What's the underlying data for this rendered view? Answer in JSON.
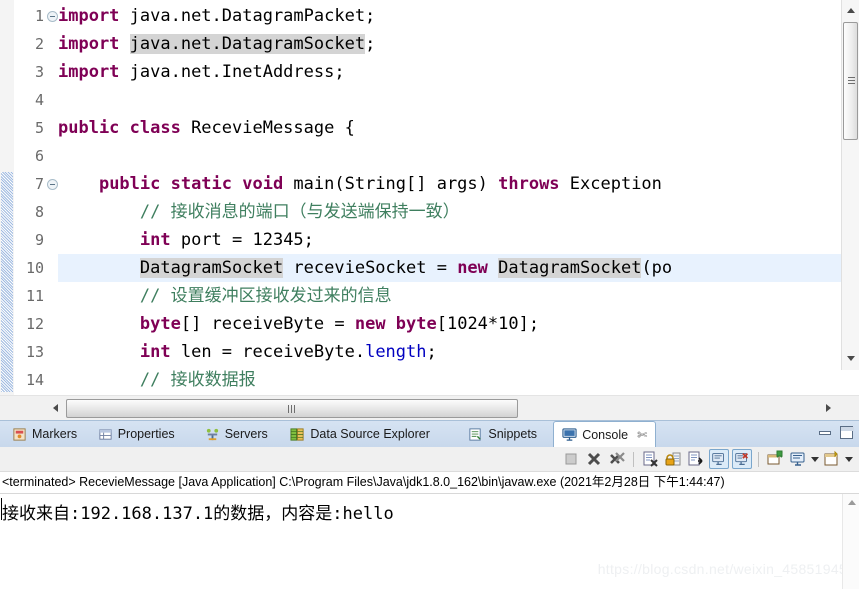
{
  "editor": {
    "lines": [
      {
        "n": "1",
        "fold": true,
        "cur": false,
        "segs": [
          {
            "t": "import ",
            "c": "kw"
          },
          {
            "t": "java.net.DatagramPacket;",
            "c": ""
          }
        ]
      },
      {
        "n": "2",
        "fold": false,
        "cur": false,
        "segs": [
          {
            "t": "import ",
            "c": "kw"
          },
          {
            "t": "java.net.DatagramSocket",
            "c": "occ"
          },
          {
            "t": ";",
            "c": ""
          }
        ]
      },
      {
        "n": "3",
        "fold": false,
        "cur": false,
        "segs": [
          {
            "t": "import ",
            "c": "kw"
          },
          {
            "t": "java.net.InetAddress;",
            "c": ""
          }
        ]
      },
      {
        "n": "4",
        "fold": false,
        "cur": false,
        "segs": []
      },
      {
        "n": "5",
        "fold": false,
        "cur": false,
        "segs": [
          {
            "t": "public class ",
            "c": "kw"
          },
          {
            "t": "RecevieMessage {",
            "c": ""
          }
        ]
      },
      {
        "n": "6",
        "fold": false,
        "cur": false,
        "segs": []
      },
      {
        "n": "7",
        "fold": true,
        "cur": false,
        "segs": [
          {
            "t": "    ",
            "c": ""
          },
          {
            "t": "public static void ",
            "c": "kw"
          },
          {
            "t": "main(String[] args) ",
            "c": ""
          },
          {
            "t": "throws ",
            "c": "kw"
          },
          {
            "t": "Exception",
            "c": ""
          }
        ]
      },
      {
        "n": "8",
        "fold": false,
        "cur": false,
        "segs": [
          {
            "t": "        // 接收消息的端口（与发送端保持一致）",
            "c": "cmt"
          }
        ]
      },
      {
        "n": "9",
        "fold": false,
        "cur": false,
        "segs": [
          {
            "t": "        ",
            "c": ""
          },
          {
            "t": "int ",
            "c": "kw"
          },
          {
            "t": "port = 12345;",
            "c": ""
          }
        ]
      },
      {
        "n": "10",
        "fold": false,
        "cur": true,
        "segs": [
          {
            "t": "        ",
            "c": ""
          },
          {
            "t": "DatagramSocket",
            "c": "occ"
          },
          {
            "t": " recevieSocket = ",
            "c": ""
          },
          {
            "t": "new ",
            "c": "kw"
          },
          {
            "t": "DatagramSocket",
            "c": "occ"
          },
          {
            "t": "(po",
            "c": ""
          }
        ]
      },
      {
        "n": "11",
        "fold": false,
        "cur": false,
        "segs": [
          {
            "t": "        // 设置缓冲区接收发过来的信息",
            "c": "cmt"
          }
        ]
      },
      {
        "n": "12",
        "fold": false,
        "cur": false,
        "segs": [
          {
            "t": "        ",
            "c": ""
          },
          {
            "t": "byte",
            "c": "kw"
          },
          {
            "t": "[] receiveByte = ",
            "c": ""
          },
          {
            "t": "new byte",
            "c": "kw"
          },
          {
            "t": "[1024*10];",
            "c": ""
          }
        ]
      },
      {
        "n": "13",
        "fold": false,
        "cur": false,
        "segs": [
          {
            "t": "        ",
            "c": ""
          },
          {
            "t": "int ",
            "c": "kw"
          },
          {
            "t": "len = receiveByte.",
            "c": ""
          },
          {
            "t": "length",
            "c": "fld"
          },
          {
            "t": ";",
            "c": ""
          }
        ]
      },
      {
        "n": "14",
        "fold": false,
        "cur": false,
        "segs": [
          {
            "t": "        // 接收数据报",
            "c": "cmt"
          }
        ]
      }
    ]
  },
  "views": {
    "tabs": [
      {
        "label": "Markers",
        "icon": "markers-icon",
        "active": false,
        "close": false
      },
      {
        "label": "Properties",
        "icon": "properties-icon",
        "active": false,
        "close": false
      },
      {
        "label": "Servers",
        "icon": "servers-icon",
        "active": false,
        "close": false
      },
      {
        "label": "Data Source Explorer",
        "icon": "data-source-explorer-icon",
        "active": false,
        "close": false
      },
      {
        "label": "Snippets",
        "icon": "snippets-icon",
        "active": false,
        "close": false
      },
      {
        "label": "Console",
        "icon": "console-icon",
        "active": true,
        "close": true
      }
    ],
    "close_glyph": "✄",
    "minimize_title": "Minimize",
    "maximize_title": "Maximize"
  },
  "console": {
    "toolbar": [
      {
        "name": "terminate-button",
        "state": "disabled"
      },
      {
        "name": "remove-launch-button",
        "state": "enabled"
      },
      {
        "name": "remove-all-terminated-button",
        "state": "enabled"
      },
      {
        "name": "clear-console-button",
        "state": "enabled"
      },
      {
        "name": "scroll-lock-button",
        "state": "enabled"
      },
      {
        "name": "word-wrap-button",
        "state": "enabled"
      },
      {
        "name": "show-console-on-output-button",
        "state": "pressed"
      },
      {
        "name": "show-console-on-error-button",
        "state": "pressed"
      },
      {
        "name": "pin-console-button",
        "state": "enabled"
      },
      {
        "name": "display-selected-console-button",
        "state": "enabled"
      },
      {
        "name": "open-console-button",
        "state": "enabled"
      }
    ],
    "status_line": "<terminated> RecevieMessage [Java Application] C:\\Program Files\\Java\\jdk1.8.0_162\\bin\\javaw.exe (2021年2月28日 下午1:44:47)",
    "output": "接收来自:192.168.137.1的数据，内容是:hello"
  },
  "watermark": "https://blog.csdn.net/weixin_45851945"
}
